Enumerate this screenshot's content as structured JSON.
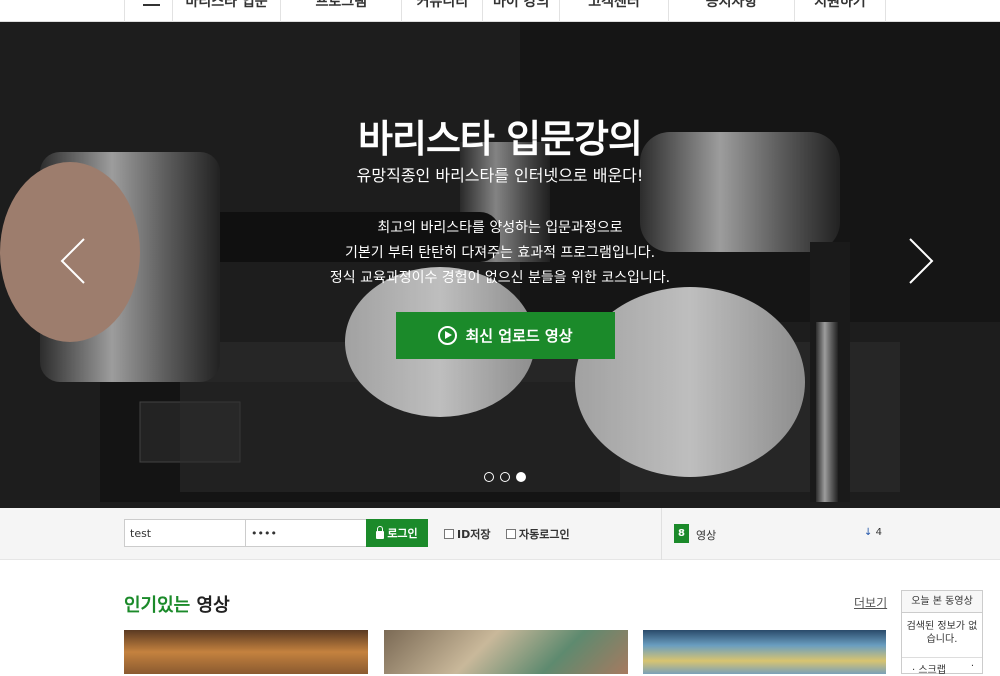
{
  "nav": {
    "menu_icon": "hamburger-icon",
    "items": [
      "바리스타 입문",
      "프로그램",
      "커뮤니티",
      "마이 강의",
      "고객센터",
      "공지사항",
      "지원하기"
    ]
  },
  "hero": {
    "title": "바리스타 입문강의",
    "subtitle": "유망직종인 바리스타를 인터넷으로 배운다!",
    "desc_line1": "최고의 바리스타를 양성하는 입문과정으로",
    "desc_line2": "기본기 부터 탄탄히 다져주는 효과적 프로그램입니다.",
    "desc_line3": "정식 교육과정이수 경험이 없으신 분들을 위한 코스입니다.",
    "button_label": "최신 업로드 영상",
    "button_icon": "play-circle-icon",
    "slide_count": 3,
    "active_slide": 3
  },
  "login": {
    "id_value": "test",
    "pw_value": "••••",
    "button_label": "로그인",
    "save_id_label": "ID저장",
    "auto_login_label": "자동로그인"
  },
  "stats": {
    "count": "8",
    "label": "영상",
    "down": "4"
  },
  "popular": {
    "title_green": "인기있는",
    "title_rest": " 영상",
    "more_label": "더보기"
  },
  "side": {
    "title": "오늘 본 동영상",
    "empty": "검색된 정보가 없습니다.",
    "scrap": "· 스크랩",
    "scrap_mark": "·"
  },
  "colors": {
    "accent": "#1b8a2a"
  }
}
